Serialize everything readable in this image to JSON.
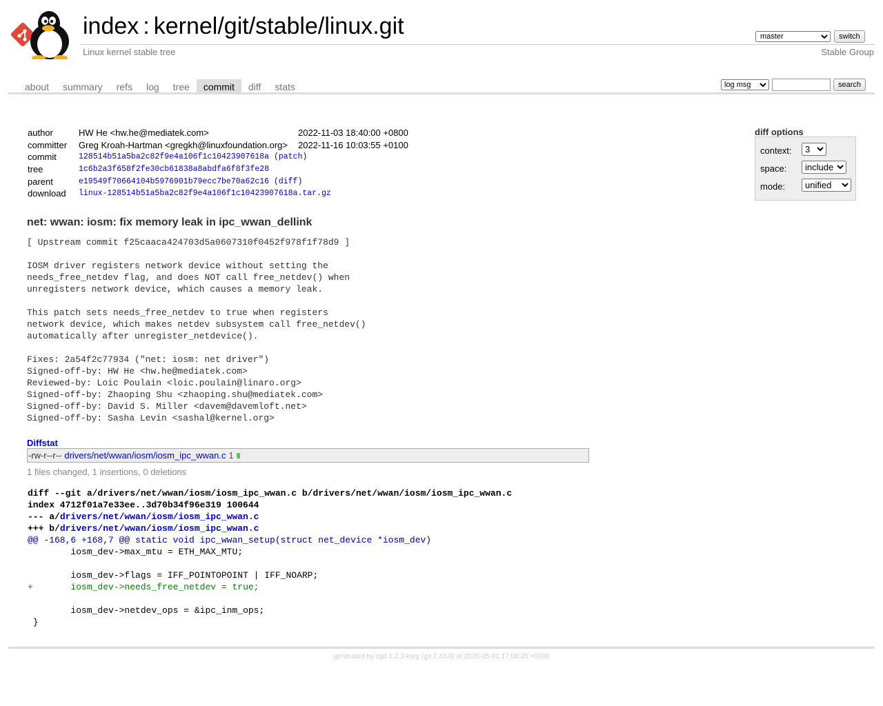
{
  "header": {
    "index_label": "index",
    "separator": ":",
    "repo_path": "kernel/git/stable/linux.git",
    "description": "Linux kernel stable tree",
    "owner": "Stable Group",
    "branch_selected": "master",
    "switch_label": "switch"
  },
  "tabs": [
    {
      "label": "about"
    },
    {
      "label": "summary"
    },
    {
      "label": "refs"
    },
    {
      "label": "log"
    },
    {
      "label": "tree"
    },
    {
      "label": "commit",
      "active": true
    },
    {
      "label": "diff"
    },
    {
      "label": "stats"
    }
  ],
  "search": {
    "mode_selected": "log msg",
    "query": "",
    "button_label": "search"
  },
  "commit_info": {
    "author_label": "author",
    "author": "HW He <hw.he@mediatek.com>",
    "author_date": "2022-11-03 18:40:00 +0800",
    "committer_label": "committer",
    "committer": "Greg Kroah-Hartman <gregkh@linuxfoundation.org>",
    "committer_date": "2022-11-16 10:03:55 +0100",
    "commit_label": "commit",
    "commit_sha": "128514b51a5ba2c82f9e4a106f1c10423907618a",
    "patch_link": "(patch)",
    "tree_label": "tree",
    "tree_sha": "1c6b2a3f658f2fe30cb61838a8abdfa6f8f3fe28",
    "parent_label": "parent",
    "parent_sha": "e19549f70664104b5976901b79ecc7be70a62c16",
    "diff_link": "(diff)",
    "download_label": "download",
    "download_file": "linux-128514b51a5ba2c82f9e4a106f1c10423907618a.tar.gz"
  },
  "diff_options": {
    "title": "diff options",
    "context_label": "context:",
    "context_value": "3",
    "space_label": "space:",
    "space_value": "include",
    "mode_label": "mode:",
    "mode_value": "unified"
  },
  "subject": "net: wwan: iosm: fix memory leak in ipc_wwan_dellink",
  "message": "[ Upstream commit f25caaca424703d5a0607310f0452f978f1f78d9 ]\n\nIOSM driver registers network device without setting the\nneeds_free_netdev flag, and does NOT call free_netdev() when\nunregisters network device, which causes a memory leak.\n\nThis patch sets needs_free_netdev to true when registers\nnetwork device, which makes netdev subsystem call free_netdev()\nautomatically after unregister_netdevice().\n\nFixes: 2a54f2c77934 (\"net: iosm: net driver\")\nSigned-off-by: HW He <hw.he@mediatek.com>\nReviewed-by: Loic Poulain <loic.poulain@linaro.org>\nSigned-off-by: Zhaoping Shu <zhaoping.shu@mediatek.com>\nSigned-off-by: David S. Miller <davem@davemloft.net>\nSigned-off-by: Sasha Levin <sashal@kernel.org>",
  "diffstat": {
    "title": "Diffstat",
    "mode": "-rw-r--r--",
    "file": "drivers/net/wwan/iosm/iosm_ipc_wwan.c",
    "count": "1",
    "summary": "1 files changed, 1 insertions, 0 deletions"
  },
  "diff": {
    "git_line": "diff --git a/drivers/net/wwan/iosm/iosm_ipc_wwan.c b/drivers/net/wwan/iosm/iosm_ipc_wwan.c",
    "index_line": "index 4712f01a7e33ee..3d70b34f96e319 100644",
    "old_prefix": "--- a/",
    "old_path": "drivers/net/wwan/iosm/iosm_ipc_wwan.c",
    "new_prefix": "+++ b/",
    "new_path": "drivers/net/wwan/iosm/iosm_ipc_wwan.c",
    "hunk": "@@ -168,6 +168,7 @@ static void ipc_wwan_setup(struct net_device *iosm_dev)",
    "lines": [
      {
        "type": "ctx",
        "text": " \tiosm_dev->max_mtu = ETH_MAX_MTU;"
      },
      {
        "type": "ctx",
        "text": " "
      },
      {
        "type": "ctx",
        "text": " \tiosm_dev->flags = IFF_POINTOPOINT | IFF_NOARP;"
      },
      {
        "type": "add",
        "text": "+\tiosm_dev->needs_free_netdev = true;"
      },
      {
        "type": "ctx",
        "text": " "
      },
      {
        "type": "ctx",
        "text": " \tiosm_dev->netdev_ops = &ipc_inm_ops;"
      },
      {
        "type": "ctx",
        "text": " }"
      }
    ]
  },
  "footer": {
    "text_prefix": "generated by ",
    "cgit_link": "cgit 1.2.3-korg",
    "text_middle": " (git 2.43.0) at 2025-05-01 17:08:35 +0000"
  }
}
